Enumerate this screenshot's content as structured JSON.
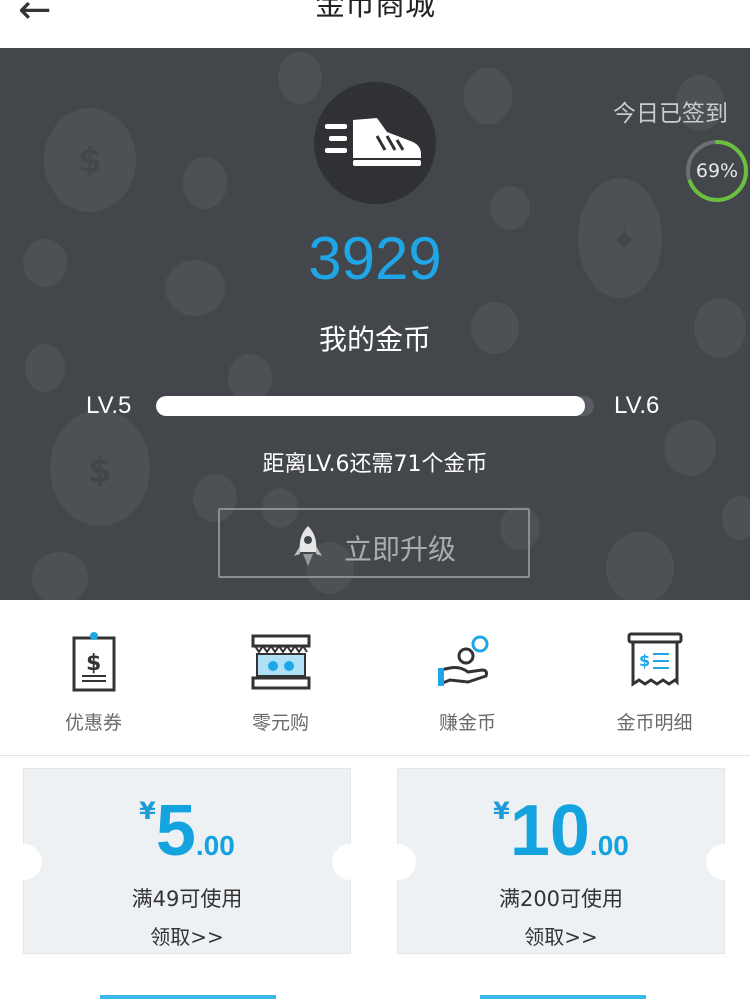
{
  "header": {
    "back_icon": "arrow-left-icon",
    "title": "金币商城"
  },
  "hero": {
    "checkin_label": "今日已签到",
    "checkin_progress_percent": 69,
    "checkin_progress_text": "69%",
    "coin_count": "3929",
    "coin_label": "我的金币",
    "level_current": "LV.5",
    "level_next": "LV.6",
    "level_progress_fraction": 0.98,
    "need_text": "距离LV.6还需71个金币",
    "upgrade_label": "立即升级",
    "colors": {
      "accent": "#1ea6e6",
      "ring": "#6abf3f",
      "hero_bg": "#43464a"
    }
  },
  "menu": {
    "items": [
      {
        "label": "优惠券",
        "icon": "coupon-tag-icon"
      },
      {
        "label": "零元购",
        "icon": "shop-stall-icon"
      },
      {
        "label": "赚金币",
        "icon": "hand-coins-icon"
      },
      {
        "label": "金币明细",
        "icon": "receipt-icon"
      }
    ]
  },
  "coupons": [
    {
      "currency": "¥",
      "amount": "5",
      "cents": ".00",
      "condition": "满49可使用",
      "action": "领取>>"
    },
    {
      "currency": "¥",
      "amount": "10",
      "cents": ".00",
      "condition": "满200可使用",
      "action": "领取>>"
    }
  ]
}
